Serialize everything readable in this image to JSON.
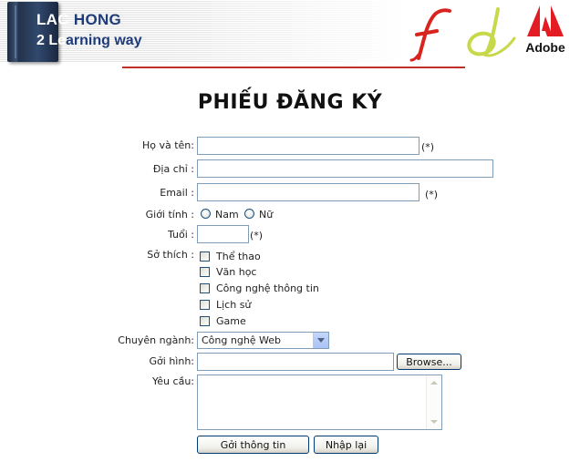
{
  "banner": {
    "logo_line1_a": "LAC",
    "logo_line1_b": " HONG",
    "logo_line2_a": "2 Le",
    "logo_line2_b": "arning way",
    "adobe_label": "Adobe",
    "icons": [
      "book-icon",
      "flash-icon",
      "dreamweaver-icon",
      "adobe-logo-icon"
    ],
    "colors": {
      "rule": "#c0302b",
      "logo_text": "#1e3b7a"
    }
  },
  "form": {
    "title": "PHIẾU ĐĂNG KÝ",
    "required_mark": "(*)",
    "fullname": {
      "label": "Họ và tên:",
      "value": ""
    },
    "address": {
      "label": "Địa chỉ :",
      "value": ""
    },
    "email": {
      "label": "Email :",
      "value": ""
    },
    "gender": {
      "label": "Giới tính :",
      "options": [
        "Nam",
        "Nữ"
      ]
    },
    "age": {
      "label": "Tuổi :",
      "value": ""
    },
    "hobbies": {
      "label": "Sở thích :",
      "options": [
        "Thể thao",
        "Văn học",
        "Công nghệ thông tin",
        "Lịch sử",
        "Game"
      ]
    },
    "major": {
      "label": "Chuyên ngành:",
      "selected": "Công nghệ Web"
    },
    "photo": {
      "label": "Gởi hình:",
      "value": "",
      "browse_label": "Browse..."
    },
    "request": {
      "label": "Yêu cầu:",
      "value": ""
    },
    "submit_label": "Gởi thông tin",
    "reset_label": "Nhập lại"
  }
}
